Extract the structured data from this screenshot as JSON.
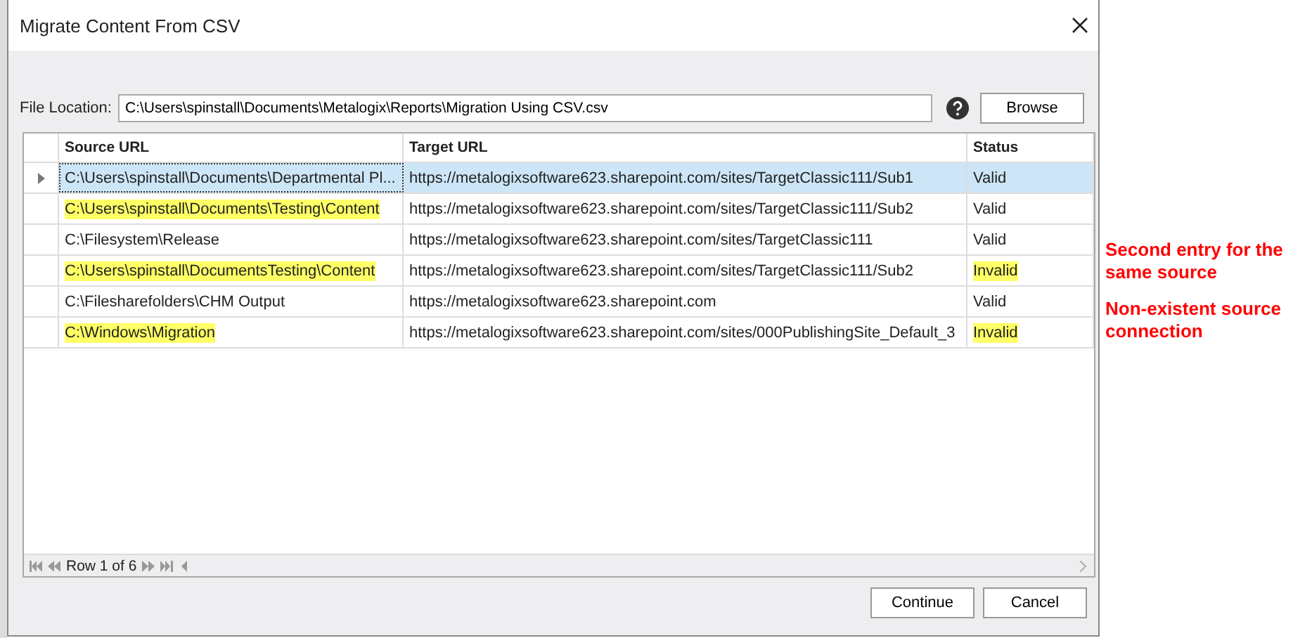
{
  "window": {
    "title": "Migrate Content From CSV"
  },
  "file_location": {
    "label": "File Location:",
    "value": "C:\\Users\\spinstall\\Documents\\Metalogix\\Reports\\Migration Using CSV.csv",
    "browse": "Browse"
  },
  "table": {
    "columns": [
      "Source URL",
      "Target URL",
      "Status"
    ],
    "rows": [
      {
        "selected": true,
        "source": "C:\\Users\\spinstall\\Documents\\Departmental Pl...",
        "source_highlighted": false,
        "target": "https://metalogixsoftware623.sharepoint.com/sites/TargetClassic111/Sub1",
        "status": "Valid",
        "status_highlighted": false
      },
      {
        "selected": false,
        "source": "C:\\Users\\spinstall\\Documents\\Testing\\Content",
        "source_highlighted": true,
        "target": "https://metalogixsoftware623.sharepoint.com/sites/TargetClassic111/Sub2",
        "status": "Valid",
        "status_highlighted": false
      },
      {
        "selected": false,
        "source": "C:\\Filesystem\\Release",
        "source_highlighted": false,
        "target": "https://metalogixsoftware623.sharepoint.com/sites/TargetClassic111",
        "status": "Valid",
        "status_highlighted": false
      },
      {
        "selected": false,
        "source": "C:\\Users\\spinstall\\DocumentsTesting\\Content",
        "source_highlighted": true,
        "target": "https://metalogixsoftware623.sharepoint.com/sites/TargetClassic111/Sub2",
        "status": "Invalid",
        "status_highlighted": true
      },
      {
        "selected": false,
        "source": "C:\\Filesharefolders\\CHM Output",
        "source_highlighted": false,
        "target": "https://metalogixsoftware623.sharepoint.com",
        "status": "Valid",
        "status_highlighted": false
      },
      {
        "selected": false,
        "source": "C:\\Windows\\Migration",
        "source_highlighted": true,
        "target": "https://metalogixsoftware623.sharepoint.com/sites/000PublishingSite_Default_3",
        "status": "Invalid",
        "status_highlighted": true
      }
    ]
  },
  "navigator": {
    "text": "Row 1 of 6"
  },
  "buttons": [
    "Continue",
    "Cancel"
  ],
  "annotations": [
    "Second entry for the same source",
    "Non-existent source connection"
  ]
}
